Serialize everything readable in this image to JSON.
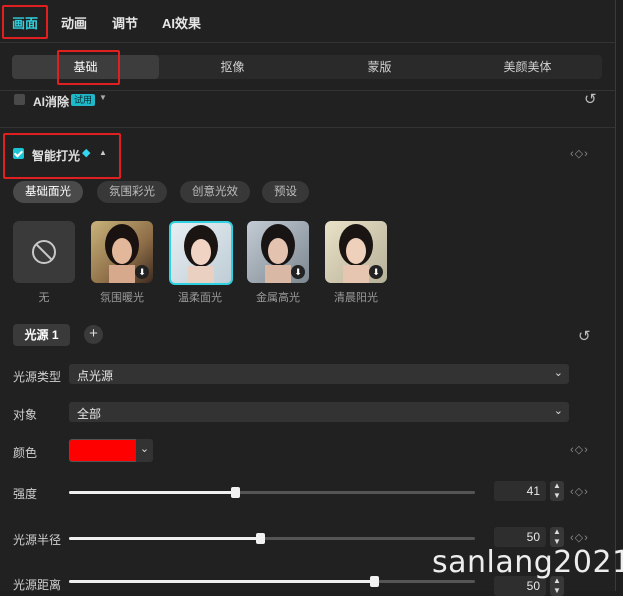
{
  "top_tabs": [
    "画面",
    "动画",
    "调节",
    "AI效果"
  ],
  "sub_tabs": [
    "基础",
    "抠像",
    "蒙版",
    "美颜美体"
  ],
  "ai_erase": {
    "label": "AI消除",
    "badge": "试用"
  },
  "smart_light": {
    "label": "智能打光",
    "checked": true
  },
  "style_pills": [
    "基础面光",
    "氛围彩光",
    "创意光效",
    "预设"
  ],
  "presets": [
    {
      "label": "无",
      "icon": "none-icon"
    },
    {
      "label": "氛围暖光",
      "icon": "download-icon"
    },
    {
      "label": "温柔面光",
      "icon": "",
      "selected": true
    },
    {
      "label": "金属高光",
      "icon": "download-icon"
    },
    {
      "label": "清晨阳光",
      "icon": "download-icon"
    }
  ],
  "light_source": {
    "label": "光源 1",
    "add": "+"
  },
  "fields": {
    "type_label": "光源类型",
    "type_value": "点光源",
    "target_label": "对象",
    "target_value": "全部",
    "color_label": "颜色",
    "color_value": "#ff0000"
  },
  "sliders": [
    {
      "label": "强度",
      "value": "41",
      "level": 0.41
    },
    {
      "label": "光源半径",
      "value": "50",
      "level": 0.47
    },
    {
      "label": "光源距离",
      "value": "50",
      "level": 0.75
    }
  ],
  "watermark": "sanlang2021",
  "colors": {
    "accent": "#2fd0e0",
    "highlight": "#e02020"
  }
}
